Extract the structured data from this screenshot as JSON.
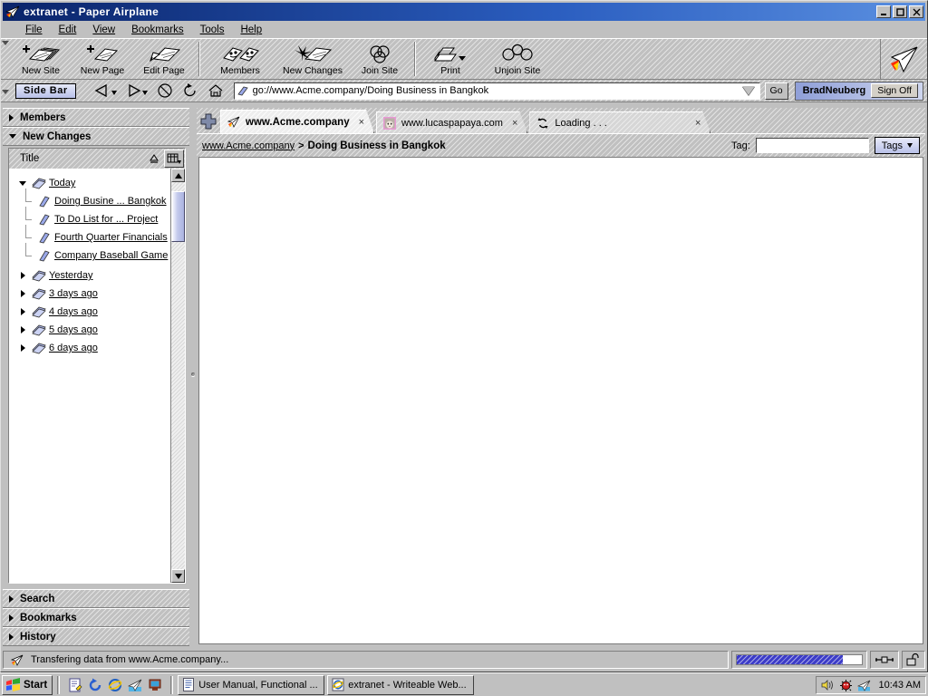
{
  "window": {
    "title": "extranet - Paper Airplane",
    "icon": "paper-airplane-icon",
    "minimize": "_",
    "maximize": "□",
    "close": "✕"
  },
  "menubar": {
    "items": [
      {
        "label": "File"
      },
      {
        "label": "Edit"
      },
      {
        "label": "View"
      },
      {
        "label": "Bookmarks"
      },
      {
        "label": "Tools"
      },
      {
        "label": "Help"
      }
    ]
  },
  "toolbar": {
    "groups": [
      {
        "buttons": [
          {
            "label": "New Site",
            "icon": "new-site-icon"
          },
          {
            "label": "New Page",
            "icon": "new-page-icon"
          },
          {
            "label": "Edit Page",
            "icon": "edit-page-icon"
          }
        ]
      },
      {
        "buttons": [
          {
            "label": "Members",
            "icon": "members-icon"
          },
          {
            "label": "New Changes",
            "icon": "new-changes-icon"
          },
          {
            "label": "Join Site",
            "icon": "join-site-icon"
          }
        ]
      },
      {
        "buttons": [
          {
            "label": "Print",
            "icon": "printer-icon"
          },
          {
            "label": "Unjoin Site",
            "icon": "unjoin-site-icon"
          }
        ]
      }
    ],
    "logo_icon": "paper-airplane-logo-icon"
  },
  "navbar": {
    "sidebar_button": "Side Bar",
    "back": "back-icon",
    "forward": "forward-icon",
    "stop": "stop-icon",
    "reload": "reload-icon",
    "home": "home-icon",
    "address": {
      "icon": "page-icon",
      "value": "go://www.Acme.company/Doing Business in Bangkok",
      "dropdown": "chevron-down-icon"
    },
    "go_label": "Go",
    "user": "BradNeuberg",
    "signoff_label": "Sign Off"
  },
  "sidebar": {
    "panels": [
      {
        "label": "Members",
        "expanded": false
      },
      {
        "label": "New Changes",
        "expanded": true
      }
    ],
    "column_header": {
      "title": "Title",
      "sort_icon": "sort-ascending-icon",
      "columns_icon": "column-chooser-icon"
    },
    "tree": [
      {
        "label": "Today",
        "level": 1,
        "expanded": true,
        "icon": "stack-pages-icon"
      },
      {
        "label": "Doing Busine ... Bangkok",
        "level": 2,
        "icon": "page-icon"
      },
      {
        "label": "To Do List for ... Project",
        "level": 2,
        "icon": "page-icon"
      },
      {
        "label": "Fourth Quarter Financials",
        "level": 2,
        "icon": "page-icon"
      },
      {
        "label": "Company Baseball Game",
        "level": 2,
        "icon": "page-icon"
      },
      {
        "label": "Yesterday",
        "level": 1,
        "expanded": false,
        "icon": "stack-pages-icon"
      },
      {
        "label": "3 days ago",
        "level": 1,
        "expanded": false,
        "icon": "stack-pages-icon"
      },
      {
        "label": "4 days ago",
        "level": 1,
        "expanded": false,
        "icon": "stack-pages-icon"
      },
      {
        "label": "5 days ago",
        "level": 1,
        "expanded": false,
        "icon": "stack-pages-icon"
      },
      {
        "label": "6 days ago",
        "level": 1,
        "expanded": false,
        "icon": "stack-pages-icon"
      }
    ],
    "bottom_panels": [
      {
        "label": "Search",
        "expanded": false
      },
      {
        "label": "Bookmarks",
        "expanded": false
      },
      {
        "label": "History",
        "expanded": false
      }
    ]
  },
  "main": {
    "new_tab_icon": "plus-icon",
    "tabs": [
      {
        "label": "www.Acme.company",
        "favicon": "paper-airplane-icon",
        "active": true,
        "close": "×"
      },
      {
        "label": "www.lucaspapaya.com",
        "favicon": "photo-favicon",
        "active": false,
        "close": "×"
      },
      {
        "label": "Loading . . .",
        "favicon": "loading-spinner-icon",
        "active": false,
        "close": "×"
      }
    ],
    "breadcrumb": {
      "root": "www.Acme.company",
      "separator": ">",
      "current": "Doing Business in Bangkok"
    },
    "tag": {
      "label": "Tag:",
      "value": "",
      "placeholder": "",
      "button_label": "Tags",
      "button_icon": "chevron-down-icon"
    }
  },
  "statusbar": {
    "icon": "paper-airplane-icon",
    "message": "Transfering data from www.Acme.company...",
    "progress_percent": 85,
    "connection_icon": "network-connection-icon",
    "security_icon": "unlocked-padlock-icon"
  },
  "taskbar": {
    "start_label": "Start",
    "start_icon": "windows-flag-icon",
    "quick_launch": [
      {
        "icon": "notepad-icon"
      },
      {
        "icon": "refresh-blue-icon"
      },
      {
        "icon": "internet-explorer-icon"
      },
      {
        "icon": "paper-airplane-icon"
      },
      {
        "icon": "show-desktop-icon"
      }
    ],
    "tasks": [
      {
        "label": "User Manual, Functional ...",
        "icon": "document-icon"
      },
      {
        "label": "extranet - Writeable Web...",
        "icon": "internet-explorer-icon"
      }
    ],
    "tray": [
      {
        "icon": "volume-icon"
      },
      {
        "icon": "antivirus-icon"
      },
      {
        "icon": "paper-airplane-icon"
      }
    ],
    "clock": "10:43 AM"
  }
}
